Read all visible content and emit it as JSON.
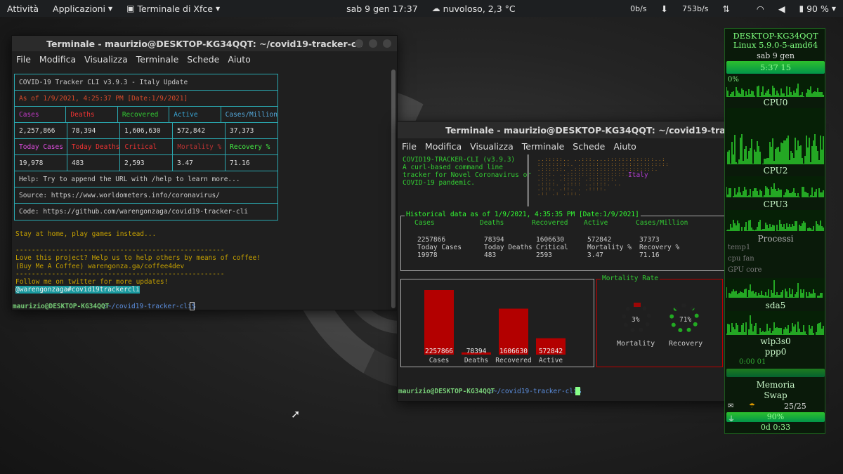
{
  "panel": {
    "activities": "Attività",
    "applications": "Applicazioni",
    "task": "Terminale di Xfce",
    "clock": "sab 9 gen  17:37",
    "weather": "nuvoloso, 2,3 °C",
    "net_up": "0b/s",
    "net_down": "753b/s",
    "battery": "90 %"
  },
  "win1": {
    "title": "Terminale - maurizio@DESKTOP-KG34QQT: ~/covid19-tracker-cli",
    "menu": [
      "File",
      "Modifica",
      "Visualizza",
      "Terminale",
      "Schede",
      "Aiuto"
    ],
    "header": "COVID-19 Tracker CLI v3.9.3 - Italy Update",
    "asof": "As of 1/9/2021, 4:25:37 PM [Date:1/9/2021]",
    "labels1": [
      "Cases",
      "Deaths",
      "Recovered",
      "Active",
      "Cases/Million"
    ],
    "values1": [
      "2,257,866",
      "78,394",
      "1,606,630",
      "572,842",
      "37,373"
    ],
    "labels2": [
      "Today Cases",
      "Today Deaths",
      "Critical",
      "Mortality %",
      "Recovery %"
    ],
    "values2": [
      "19,978",
      "483",
      "2,593",
      "3.47",
      "71.16"
    ],
    "help": "Help: Try to append the URL with /help to learn more...",
    "source": "Source: https://www.worldometers.info/coronavirus/",
    "code": "Code: https://github.com/warengonzaga/covid19-tracker-cli",
    "stay": "Stay at home, play games instead...",
    "sep": "----------------------------------------------------",
    "love": "Love this project? Help us to help others by means of coffee!",
    "coffee": "(Buy Me A Coffee) warengonza.ga/coffee4dev",
    "follow": "Follow me on twitter for more updates!",
    "tag1": "@warengonzaga",
    "tag2": "#covid19trackercli",
    "prompt_user": "maurizio@DESKTOP-KG34QQT",
    "prompt_path": ":~/covid19-tracker-cli$"
  },
  "win2": {
    "title": "Terminale - maurizio@DESKTOP-KG34QQT: ~/covid19-tracker-cli",
    "menu": [
      "File",
      "Modifica",
      "Visualizza",
      "Terminale",
      "Schede",
      "Aiuto"
    ],
    "intro": [
      "COVID19-TRACKER-CLI (v3.9.3)",
      "A curl-based command line",
      "tracker for Novel Coronavirus or",
      "COVID-19 pandemic."
    ],
    "map_label": "Italy",
    "hist_title": "Historical data as of 1/9/2021, 4:35:35 PM [Date:1/9/2021]",
    "hist_labels1": [
      "Cases",
      "Deaths",
      "Recovered",
      "Active",
      "Cases/Million"
    ],
    "hist_values1": [
      "2257866",
      "78394",
      "1606630",
      "572842",
      "37373"
    ],
    "hist_labels2": [
      "Today Cases",
      "Today Deaths",
      "Critical",
      "Mortality %",
      "Recovery %"
    ],
    "hist_values2": [
      "19978",
      "483",
      "2593",
      "3.47",
      "71.16"
    ],
    "mortality_title": "Mortality Rate",
    "donut1_value": "3%",
    "donut1_label": "Mortality",
    "donut2_value": "71%",
    "donut2_label": "Recovery",
    "prompt_user": "maurizio@DESKTOP-KG34QQT",
    "prompt_path": ":~/covid19-tracker-cli$"
  },
  "chart_data": {
    "type": "bar",
    "categories": [
      "Cases",
      "Deaths",
      "Recovered",
      "Active"
    ],
    "values": [
      2257866,
      78394,
      1606630,
      572842
    ],
    "value_labels": [
      "2257866",
      "78394",
      "1606630",
      "572842"
    ],
    "color": "#b30000"
  },
  "conky": {
    "host": "DESKTOP-KG34QQT",
    "kernel": "Linux 5.9.0-5-amd64",
    "date": "sab  9 gen",
    "time": "5:37 15",
    "cpu0": "CPU0",
    "cpu2": "CPU2",
    "cpu3": "CPU3",
    "procs": "Processi",
    "sda": "sda5",
    "wlan": "wlp3s0",
    "ppp": "ppp0",
    "uptime_small": "0:00 01",
    "mem": "Memoria",
    "swap": "Swap",
    "mail": "25/25",
    "batt": "90%",
    "uptime": "0d  0:33",
    "pct": "0%",
    "temp": "temp1",
    "cpu_fan": "cpu fan",
    "gpu_core": "GPU core"
  }
}
